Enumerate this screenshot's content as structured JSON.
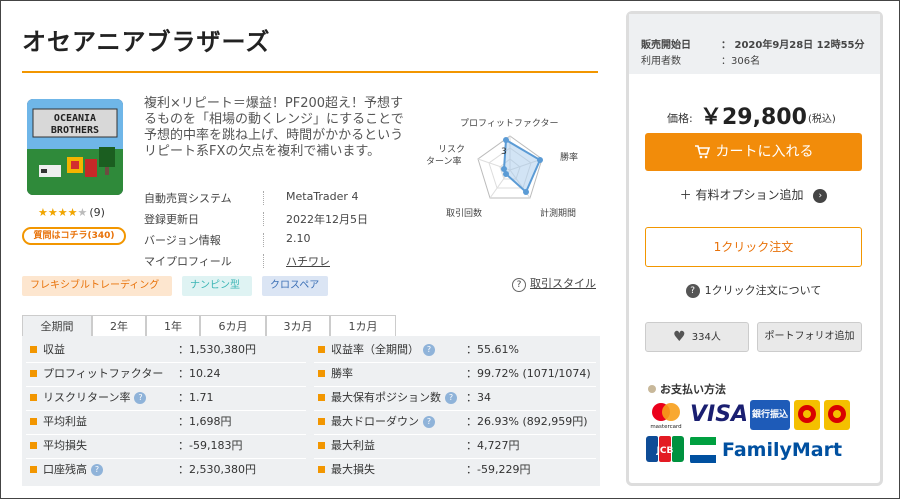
{
  "product": {
    "title": "オセアニアブラザーズ",
    "image_text_line1": "OCEANIA",
    "image_text_line2": "BROTHERS",
    "rating_stars": "★★★★★",
    "rating_value": 4,
    "rating_count": "(9)",
    "qa_label": "質問はコチラ(340)",
    "description": "複利×リピート＝爆益！PF200超え！予想するものを「相場の動くレンジ」にすることで予想的中率を跳ね上げ、時間がかかるというリピート系FXの欠点を複利で補います。"
  },
  "info": [
    {
      "label": "自動売買システム",
      "value": "MetaTrader 4"
    },
    {
      "label": "登録更新日",
      "value": "2022年12月5日"
    },
    {
      "label": "バージョン情報",
      "value": "2.10"
    },
    {
      "label": "マイプロフィール",
      "value": "ハチワレ"
    }
  ],
  "radar": {
    "labels": [
      "プロフィットファクター",
      "勝率",
      "計測期間",
      "取引回数",
      "リスク\nターン率"
    ],
    "label_profit": "プロフィットファクター",
    "label_win": "勝率",
    "label_period": "計測期間",
    "label_trades": "取引回数",
    "label_risk_1": "リスク",
    "label_risk_2": "ターン率",
    "scale_label": "3"
  },
  "tags": [
    "フレキシブルトレーディング",
    "ナンピン型",
    "クロスペア"
  ],
  "style_link": "取引スタイル",
  "tabs": [
    "全期間",
    "2年",
    "1年",
    "6カ月",
    "3カ月",
    "1カ月"
  ],
  "stats_left": [
    {
      "label": "収益",
      "value": "：1,530,380円",
      "help": false
    },
    {
      "label": "プロフィットファクター",
      "value": "：10.24",
      "help": false
    },
    {
      "label": "リスクリターン率",
      "value": "：1.71",
      "help": true
    },
    {
      "label": "平均利益",
      "value": "：1,698円",
      "help": false
    },
    {
      "label": "平均損失",
      "value": "：-59,183円",
      "help": false
    },
    {
      "label": "口座残高",
      "value": "：2,530,380円",
      "help": true
    }
  ],
  "stats_right": [
    {
      "label": "収益率（全期間）",
      "value": "：55.61%",
      "help": true
    },
    {
      "label": "勝率",
      "value": "：99.72% (1071/1074)",
      "help": false
    },
    {
      "label": "最大保有ポジション数",
      "value": "：34",
      "help": true
    },
    {
      "label": "最大ドローダウン",
      "value": "：26.93% (892,959円)",
      "help": true
    },
    {
      "label": "最大利益",
      "value": "：4,727円",
      "help": false
    },
    {
      "label": "最大損失",
      "value": "：-59,229円",
      "help": false
    }
  ],
  "sale": {
    "start_label": "販売開始日",
    "start_value": "：  2020年9月28日 12時55分",
    "users_label": "利用者数",
    "users_value": "：306名",
    "price_label": "価格:",
    "price": "￥29,800",
    "tax": "(税込)",
    "cart": "カートに入れる",
    "option": "有料オプション追加",
    "option_plus": "＋",
    "one_click": "1クリック注文",
    "about": "1クリック注文について",
    "fav": "334人",
    "portfolio": "ポートフォリオ追加",
    "pay_title": "お支払い方法",
    "mc_label": "mastercard",
    "visa": "VISA",
    "bank": "銀行振込",
    "jcb": "JCB",
    "family": "FamilyMart"
  },
  "colors": {
    "accent": "#f29600",
    "cart": "#f28c0a"
  }
}
